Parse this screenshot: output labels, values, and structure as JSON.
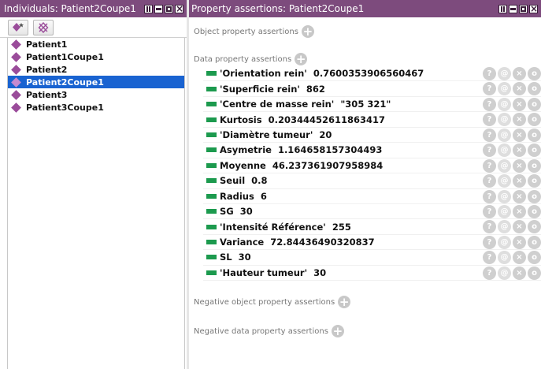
{
  "left_panel": {
    "title": "Individuals: Patient2Coupe1",
    "items": [
      {
        "label": "Patient1",
        "selected": false
      },
      {
        "label": "Patient1Coupe1",
        "selected": false
      },
      {
        "label": "Patient2",
        "selected": false
      },
      {
        "label": "Patient2Coupe1",
        "selected": true
      },
      {
        "label": "Patient3",
        "selected": false
      },
      {
        "label": "Patient3Coupe1",
        "selected": false
      }
    ]
  },
  "right_panel": {
    "title": "Property assertions: Patient2Coupe1",
    "object_section_label": "Object property assertions",
    "data_section_label": "Data property assertions",
    "negative_object_section_label": "Negative object property assertions",
    "negative_data_section_label": "Negative data property assertions",
    "data_assertions": [
      "'Orientation rein'  0.7600353906560467",
      "'Superficie rein'  862",
      "'Centre de masse rein'  \"305 321\"",
      "Kurtosis  0.20344452611863417",
      "'Diamètre tumeur'  20",
      "Asymetrie  1.164658157304493",
      "Moyenne  46.237361907958984",
      "Seuil  0.8",
      "Radius  6",
      "SG  30",
      "'Intensité Référence'  255",
      "Variance  72.84436490320837",
      "SL  30",
      "'Hauteur tumeur'  30"
    ],
    "row_button_glyphs": {
      "annotate": "?",
      "at": "@",
      "delete": "×",
      "options": "o"
    }
  },
  "add_glyph": "+",
  "colors": {
    "header_bg": "#7d4b7d",
    "individual_icon": "#9a4c9a",
    "selection": "#1963d1",
    "data_property_marker": "#1c9a4e"
  }
}
